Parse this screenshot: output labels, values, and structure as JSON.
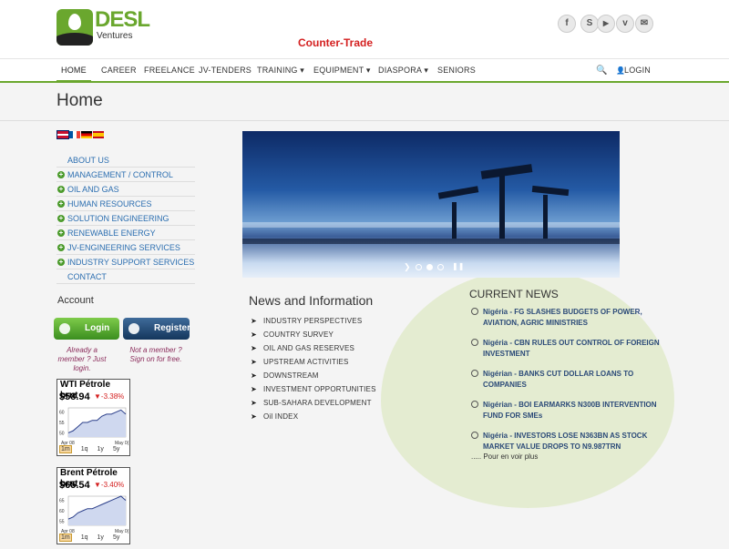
{
  "brand": {
    "name": "DESL",
    "sub": "Ventures",
    "tagline": "Counter-Trade",
    "accent": "#6aa72e"
  },
  "social": [
    "f",
    "S",
    "▶",
    "v",
    "✉"
  ],
  "nav": {
    "items": [
      "HOME",
      "CAREER",
      "FREELANCE",
      "JV-TENDERS",
      "TRAINING ▾",
      "EQUIPMENT ▾",
      "DIASPORA ▾",
      "SENIORS"
    ],
    "login": "LOGIN"
  },
  "page_title": "Home",
  "sidebar": {
    "menu": [
      "ABOUT US",
      "MANAGEMENT / CONTROL",
      "OIL AND GAS",
      "HUMAN RESOURCES",
      "SOLUTION ENGINEERING",
      "RENEWABLE ENERGY",
      "JV-ENGINEERING SERVICES",
      "INDUSTRY SUPPORT SERVICES",
      "CONTACT"
    ],
    "account_title": "Account",
    "login_btn": "Login",
    "register_btn": "Register",
    "login_hint": "Already a member ? Just login.",
    "register_hint": "Not a member ? Sign on for free."
  },
  "tickers": [
    {
      "name": "WTI Pétrole brut",
      "price": "$58.94",
      "change": "▼-3.38%",
      "tabs": [
        "1m",
        "1q",
        "1y",
        "5y"
      ],
      "x_labels": [
        "Apr 08",
        "May 0("
      ],
      "y_labels": [
        "60",
        "55",
        "50"
      ],
      "values": [
        50,
        51,
        53,
        55,
        55,
        56,
        56,
        58,
        59,
        59,
        60,
        61,
        59
      ]
    },
    {
      "name": "Brent Pétrole brut",
      "price": "$65.54",
      "change": "▼-3.40%",
      "tabs": [
        "1m",
        "1q",
        "1y",
        "5y"
      ],
      "x_labels": [
        "Apr 08",
        "May 0("
      ],
      "y_labels": [
        "65",
        "60",
        "55"
      ],
      "values": [
        56,
        57,
        59,
        60,
        61,
        61,
        62,
        63,
        64,
        65,
        66,
        67,
        65
      ]
    }
  ],
  "news_info": {
    "title": "News and Information",
    "items": [
      "INDUSTRY PERSPECTIVES",
      "COUNTRY SURVEY",
      "OIL AND GAS RESERVES",
      "UPSTREAM ACTIVITIES",
      "DOWNSTREAM",
      "INVESTMENT OPPORTUNITIES",
      "SUB-SAHARA DEVELOPMENT",
      "Oil INDEX"
    ]
  },
  "current_news": {
    "title": "CURRENT NEWS",
    "items": [
      "Nigéria - FG SLASHES BUDGETS OF POWER, AVIATION, AGRIC MINISTRIES",
      "Nigéria - CBN RULES OUT CONTROL OF FOREIGN INVESTMENT",
      "Nigérian - BANKS CUT DOLLAR LOANS TO COMPANIES",
      "Nigérian - BOI EARMARKS N300B INTERVENTION FUND FOR SMEs",
      "Nigéria - INVESTORS LOSE N363BN AS STOCK MARKET VALUE DROPS TO N9.987TRN"
    ],
    "more": "..... Pour en voir plus"
  }
}
